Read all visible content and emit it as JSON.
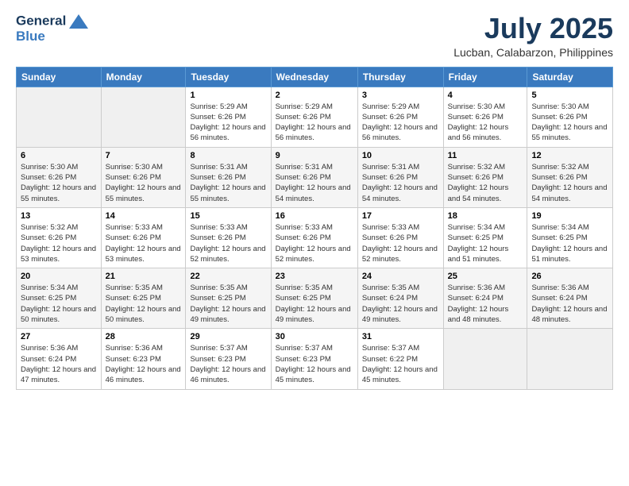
{
  "header": {
    "logo_line1": "General",
    "logo_line2": "Blue",
    "month": "July 2025",
    "location": "Lucban, Calabarzon, Philippines"
  },
  "days_of_week": [
    "Sunday",
    "Monday",
    "Tuesday",
    "Wednesday",
    "Thursday",
    "Friday",
    "Saturday"
  ],
  "weeks": [
    [
      {
        "num": "",
        "detail": ""
      },
      {
        "num": "",
        "detail": ""
      },
      {
        "num": "1",
        "detail": "Sunrise: 5:29 AM\nSunset: 6:26 PM\nDaylight: 12 hours and 56 minutes."
      },
      {
        "num": "2",
        "detail": "Sunrise: 5:29 AM\nSunset: 6:26 PM\nDaylight: 12 hours and 56 minutes."
      },
      {
        "num": "3",
        "detail": "Sunrise: 5:29 AM\nSunset: 6:26 PM\nDaylight: 12 hours and 56 minutes."
      },
      {
        "num": "4",
        "detail": "Sunrise: 5:30 AM\nSunset: 6:26 PM\nDaylight: 12 hours and 56 minutes."
      },
      {
        "num": "5",
        "detail": "Sunrise: 5:30 AM\nSunset: 6:26 PM\nDaylight: 12 hours and 55 minutes."
      }
    ],
    [
      {
        "num": "6",
        "detail": "Sunrise: 5:30 AM\nSunset: 6:26 PM\nDaylight: 12 hours and 55 minutes."
      },
      {
        "num": "7",
        "detail": "Sunrise: 5:30 AM\nSunset: 6:26 PM\nDaylight: 12 hours and 55 minutes."
      },
      {
        "num": "8",
        "detail": "Sunrise: 5:31 AM\nSunset: 6:26 PM\nDaylight: 12 hours and 55 minutes."
      },
      {
        "num": "9",
        "detail": "Sunrise: 5:31 AM\nSunset: 6:26 PM\nDaylight: 12 hours and 54 minutes."
      },
      {
        "num": "10",
        "detail": "Sunrise: 5:31 AM\nSunset: 6:26 PM\nDaylight: 12 hours and 54 minutes."
      },
      {
        "num": "11",
        "detail": "Sunrise: 5:32 AM\nSunset: 6:26 PM\nDaylight: 12 hours and 54 minutes."
      },
      {
        "num": "12",
        "detail": "Sunrise: 5:32 AM\nSunset: 6:26 PM\nDaylight: 12 hours and 54 minutes."
      }
    ],
    [
      {
        "num": "13",
        "detail": "Sunrise: 5:32 AM\nSunset: 6:26 PM\nDaylight: 12 hours and 53 minutes."
      },
      {
        "num": "14",
        "detail": "Sunrise: 5:33 AM\nSunset: 6:26 PM\nDaylight: 12 hours and 53 minutes."
      },
      {
        "num": "15",
        "detail": "Sunrise: 5:33 AM\nSunset: 6:26 PM\nDaylight: 12 hours and 52 minutes."
      },
      {
        "num": "16",
        "detail": "Sunrise: 5:33 AM\nSunset: 6:26 PM\nDaylight: 12 hours and 52 minutes."
      },
      {
        "num": "17",
        "detail": "Sunrise: 5:33 AM\nSunset: 6:26 PM\nDaylight: 12 hours and 52 minutes."
      },
      {
        "num": "18",
        "detail": "Sunrise: 5:34 AM\nSunset: 6:25 PM\nDaylight: 12 hours and 51 minutes."
      },
      {
        "num": "19",
        "detail": "Sunrise: 5:34 AM\nSunset: 6:25 PM\nDaylight: 12 hours and 51 minutes."
      }
    ],
    [
      {
        "num": "20",
        "detail": "Sunrise: 5:34 AM\nSunset: 6:25 PM\nDaylight: 12 hours and 50 minutes."
      },
      {
        "num": "21",
        "detail": "Sunrise: 5:35 AM\nSunset: 6:25 PM\nDaylight: 12 hours and 50 minutes."
      },
      {
        "num": "22",
        "detail": "Sunrise: 5:35 AM\nSunset: 6:25 PM\nDaylight: 12 hours and 49 minutes."
      },
      {
        "num": "23",
        "detail": "Sunrise: 5:35 AM\nSunset: 6:25 PM\nDaylight: 12 hours and 49 minutes."
      },
      {
        "num": "24",
        "detail": "Sunrise: 5:35 AM\nSunset: 6:24 PM\nDaylight: 12 hours and 49 minutes."
      },
      {
        "num": "25",
        "detail": "Sunrise: 5:36 AM\nSunset: 6:24 PM\nDaylight: 12 hours and 48 minutes."
      },
      {
        "num": "26",
        "detail": "Sunrise: 5:36 AM\nSunset: 6:24 PM\nDaylight: 12 hours and 48 minutes."
      }
    ],
    [
      {
        "num": "27",
        "detail": "Sunrise: 5:36 AM\nSunset: 6:24 PM\nDaylight: 12 hours and 47 minutes."
      },
      {
        "num": "28",
        "detail": "Sunrise: 5:36 AM\nSunset: 6:23 PM\nDaylight: 12 hours and 46 minutes."
      },
      {
        "num": "29",
        "detail": "Sunrise: 5:37 AM\nSunset: 6:23 PM\nDaylight: 12 hours and 46 minutes."
      },
      {
        "num": "30",
        "detail": "Sunrise: 5:37 AM\nSunset: 6:23 PM\nDaylight: 12 hours and 45 minutes."
      },
      {
        "num": "31",
        "detail": "Sunrise: 5:37 AM\nSunset: 6:22 PM\nDaylight: 12 hours and 45 minutes."
      },
      {
        "num": "",
        "detail": ""
      },
      {
        "num": "",
        "detail": ""
      }
    ]
  ]
}
